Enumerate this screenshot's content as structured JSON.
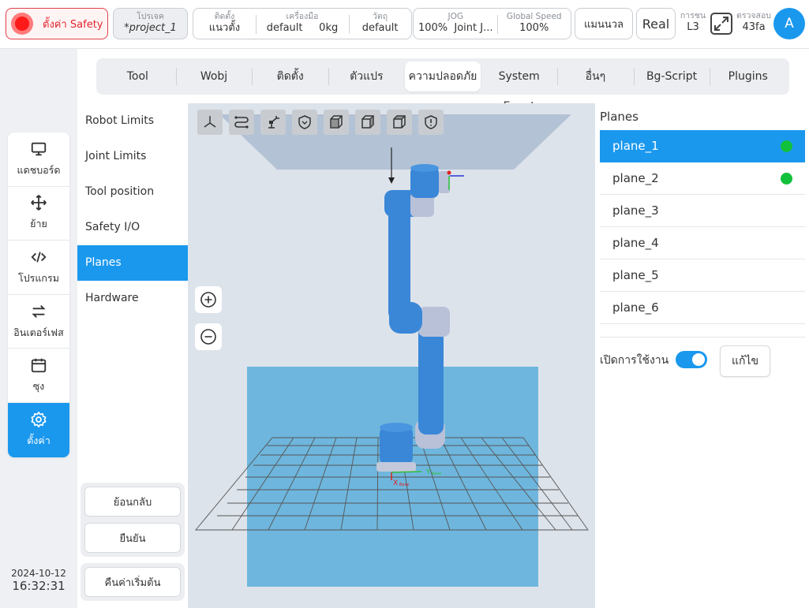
{
  "topbar": {
    "safety_label": "ตั้งค่า Safety",
    "project_label": "โปรเจค",
    "project_value": "*project_1",
    "install_label": "ติดตั้ง",
    "install_value": "แนวตั้ง",
    "tool_label": "เครื่องมือ",
    "tool_value": "default",
    "tool_weight": "0kg",
    "object_label": "วัตถุ",
    "object_value": "default",
    "jog_label": "JOG",
    "jog_value": "100%",
    "jog_mode": "Joint J...",
    "speed_label": "Global Speed",
    "speed_value": "100%",
    "manual_label": "แมนนวล",
    "real_label": "Real",
    "collision_label": "การชน",
    "collision_value": "L3",
    "checksum_label": "ตรวจสอบ",
    "checksum_value": "43fa",
    "avatar_letter": "A"
  },
  "nav": {
    "items": [
      {
        "label": "แดชบอร์ด",
        "icon": "monitor-icon"
      },
      {
        "label": "ย้าย",
        "icon": "move-icon"
      },
      {
        "label": "โปรแกรม",
        "icon": "code-icon"
      },
      {
        "label": "อินเตอร์เฟส",
        "icon": "swap-icon"
      },
      {
        "label": "ซุง",
        "icon": "calendar-icon"
      },
      {
        "label": "ตั้งค่า",
        "icon": "gear-icon"
      }
    ],
    "active": 5
  },
  "datetime": {
    "date": "2024-10-12",
    "time": "16:32:31"
  },
  "tabs": {
    "items": [
      "Tool",
      "Wobj",
      "ติดตั้ง",
      "ตัวแปร",
      "ความปลอดภัย",
      "System Event",
      "อื่นๆ",
      "Bg-Script",
      "Plugins"
    ],
    "active": 4
  },
  "submenu": {
    "items": [
      "Robot Limits",
      "Joint Limits",
      "Tool position",
      "Safety I/O",
      "Planes",
      "Hardware"
    ],
    "active": 4,
    "back_label": "ย้อนกลับ",
    "confirm_label": "ยืนยัน",
    "reset_label": "คืนค่าเริ่มต้น"
  },
  "viewport": {
    "base_x_label": "X",
    "base_y_label": "Y",
    "base_sub": "Base",
    "colors": {
      "plane_top": "#a9b9cf",
      "plane_bottom": "#5aaedb",
      "robot_blue": "#3a87d8",
      "robot_grey": "#b9c1d8"
    }
  },
  "planes": {
    "title": "Planes",
    "items": [
      {
        "name": "plane_1",
        "enabled": true
      },
      {
        "name": "plane_2",
        "enabled": true
      },
      {
        "name": "plane_3",
        "enabled": false
      },
      {
        "name": "plane_4",
        "enabled": false
      },
      {
        "name": "plane_5",
        "enabled": false
      },
      {
        "name": "plane_6",
        "enabled": false
      }
    ],
    "active": 0,
    "enable_label": "เปิดการใช้งาน",
    "edit_label": "แก้ไข",
    "status_color": "#12c13b"
  },
  "accent": "#1a98ee"
}
